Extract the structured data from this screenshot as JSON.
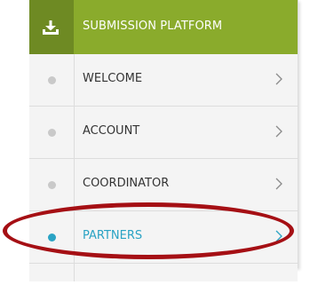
{
  "header": {
    "title": "SUBMISSION PLATFORM",
    "icon": "download-icon",
    "color": "#8aab2c"
  },
  "nav": {
    "items": [
      {
        "label": "WELCOME",
        "active": false
      },
      {
        "label": "ACCOUNT",
        "active": false
      },
      {
        "label": "COORDINATOR",
        "active": false
      },
      {
        "label": "PARTNERS",
        "active": true
      }
    ]
  },
  "colors": {
    "active": "#2aa3c4",
    "inactive_dot": "#c9c9c9",
    "annotation": "#a50f14"
  }
}
